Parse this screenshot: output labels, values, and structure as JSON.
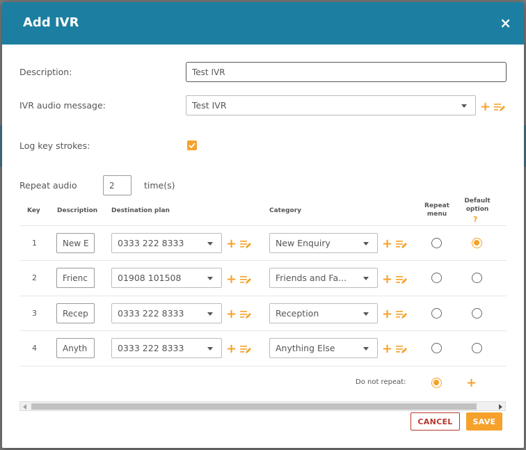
{
  "modal": {
    "title": "Add IVR",
    "close_glyph": "×"
  },
  "form": {
    "description_label": "Description:",
    "description_value": "Test IVR",
    "audio_label": "IVR audio message:",
    "audio_value": "Test IVR",
    "log_label": "Log key strokes:",
    "log_checked": true,
    "repeat_label": "Repeat audio",
    "repeat_value": "2",
    "repeat_suffix": "time(s)"
  },
  "table": {
    "headers": {
      "key": "Key",
      "description": "Description",
      "destination": "Destination plan",
      "category": "Category",
      "repeat_menu_1": "Repeat",
      "repeat_menu_2": "menu",
      "default_1": "Default",
      "default_2": "option",
      "default_help": "?"
    },
    "rows": [
      {
        "key": "1",
        "description": "New E",
        "destination": "0333 222 8333",
        "category": "New Enquiry",
        "repeat_menu": false,
        "default_option": true
      },
      {
        "key": "2",
        "description": "Frienc",
        "destination": "01908 101508",
        "category": "Friends and Fa...",
        "repeat_menu": false,
        "default_option": false
      },
      {
        "key": "3",
        "description": "Recep",
        "destination": "0333 222 8333",
        "category": "Reception",
        "repeat_menu": false,
        "default_option": false
      },
      {
        "key": "4",
        "description": "Anyth",
        "destination": "0333 222 8333",
        "category": "Anything Else",
        "repeat_menu": false,
        "default_option": false
      }
    ],
    "do_not_repeat_label": "Do not repeat:",
    "do_not_repeat_selected": true
  },
  "actions": {
    "cancel": "CANCEL",
    "save": "SAVE"
  },
  "icons": {
    "add": "plus-icon",
    "edit_list": "list-edit-icon",
    "dropdown": "caret-down-icon",
    "check": "check-icon",
    "close": "close-icon"
  },
  "colors": {
    "header": "#1c7fa1",
    "accent": "#f5a12b",
    "cancel": "#b5362c"
  }
}
